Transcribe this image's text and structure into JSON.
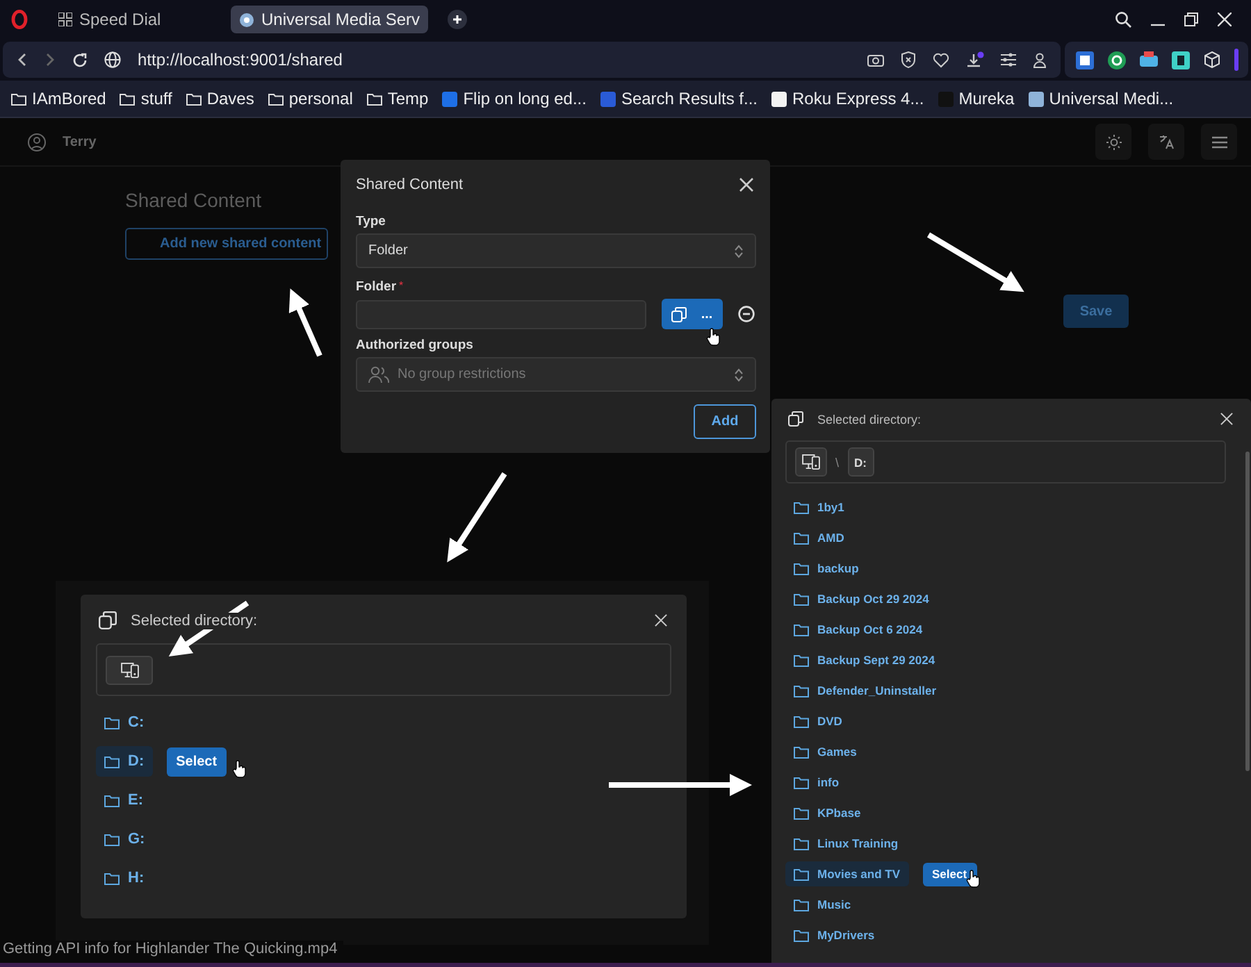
{
  "browser": {
    "tabs": [
      {
        "label": "Speed Dial",
        "selected": false
      },
      {
        "label": "Universal Media Serv",
        "selected": true
      }
    ],
    "url": "http://localhost:9001/shared",
    "bookmarks": [
      {
        "label": "IAmBored",
        "kind": "folder"
      },
      {
        "label": "stuff",
        "kind": "folder"
      },
      {
        "label": "Daves",
        "kind": "folder"
      },
      {
        "label": "personal",
        "kind": "folder"
      },
      {
        "label": "Temp",
        "kind": "folder"
      },
      {
        "label": "Flip on long ed...",
        "kind": "site",
        "color": "#1e6fe6"
      },
      {
        "label": "Search Results f...",
        "kind": "site",
        "color": "#2a5bd7"
      },
      {
        "label": "Roku Express 4...",
        "kind": "site",
        "color": "#f2f2f2"
      },
      {
        "label": "Mureka",
        "kind": "site",
        "color": "#111111"
      },
      {
        "label": "Universal Medi...",
        "kind": "site",
        "color": "#8fb3d9"
      }
    ]
  },
  "header": {
    "user": "Terry"
  },
  "page": {
    "title": "Shared Content",
    "add_button": "Add new shared content",
    "save_button": "Save"
  },
  "share_dialog": {
    "title": "Shared Content",
    "type_label": "Type",
    "type_value": "Folder",
    "folder_label": "Folder",
    "required_mark": "*",
    "browse_button": "...",
    "groups_label": "Authorized groups",
    "groups_placeholder": "No group restrictions",
    "add_button": "Add"
  },
  "directory_dialogs": [
    {
      "title": "Selected directory:",
      "select_button": "Select",
      "items": [
        {
          "label": "C:",
          "selected": false
        },
        {
          "label": "D:",
          "selected": true
        },
        {
          "label": "E:",
          "selected": false
        },
        {
          "label": "G:",
          "selected": false
        },
        {
          "label": "H:",
          "selected": false
        }
      ]
    },
    {
      "title": "Selected directory:",
      "path_separator": "\\",
      "path": [
        "D:"
      ],
      "select_button": "Select",
      "items": [
        {
          "label": "1by1",
          "selected": false
        },
        {
          "label": "AMD",
          "selected": false
        },
        {
          "label": "backup",
          "selected": false
        },
        {
          "label": "Backup Oct 29 2024",
          "selected": false
        },
        {
          "label": "Backup Oct 6 2024",
          "selected": false
        },
        {
          "label": "Backup Sept 29 2024",
          "selected": false
        },
        {
          "label": "Defender_Uninstaller",
          "selected": false
        },
        {
          "label": "DVD",
          "selected": false
        },
        {
          "label": "Games",
          "selected": false
        },
        {
          "label": "info",
          "selected": false
        },
        {
          "label": "KPbase",
          "selected": false
        },
        {
          "label": "Linux Training",
          "selected": false
        },
        {
          "label": "Movies and TV",
          "selected": true
        },
        {
          "label": "Music",
          "selected": false
        },
        {
          "label": "MyDrivers",
          "selected": false
        }
      ]
    }
  ],
  "status": "Getting API info for Highlander The Quicking.mp4"
}
